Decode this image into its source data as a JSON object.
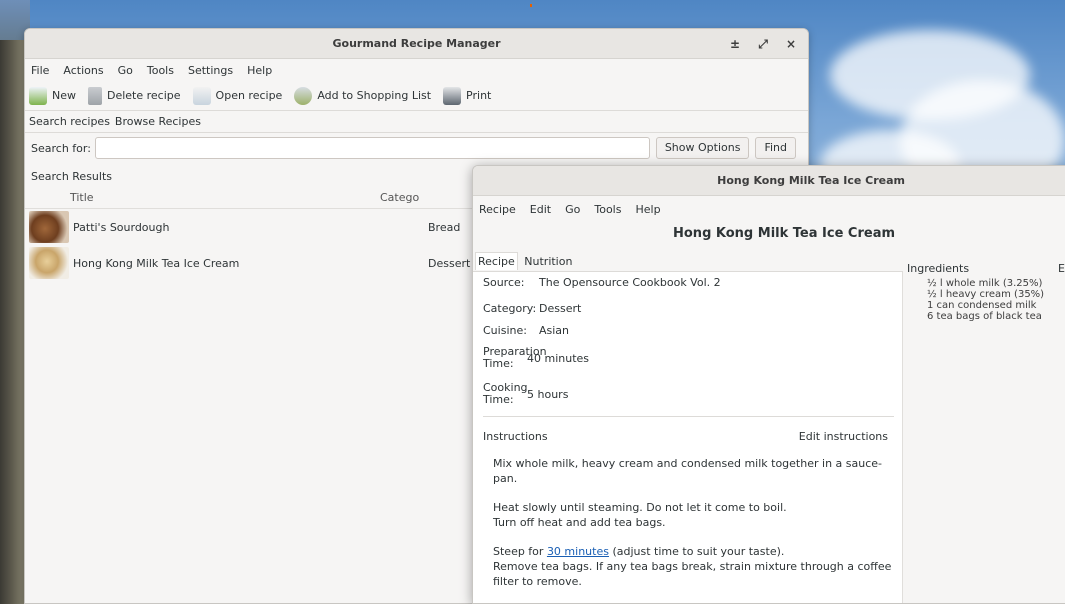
{
  "main_window": {
    "title": "Gourmand Recipe Manager",
    "controls": {
      "minimize": "±",
      "maximize": "⤢",
      "close": "×"
    },
    "menu": [
      "File",
      "Actions",
      "Go",
      "Tools",
      "Settings",
      "Help"
    ],
    "toolbar": {
      "new": "New",
      "delete": "Delete recipe",
      "open": "Open recipe",
      "shopping": "Add to Shopping List",
      "print": "Print"
    },
    "tabs": [
      "Search recipes",
      "Browse Recipes"
    ],
    "search_label": "Search for:",
    "search_value": "",
    "show_options": "Show Options",
    "find": "Find",
    "results_label": "Search Results",
    "columns": {
      "title": "Title",
      "category": "Catego"
    },
    "rows": [
      {
        "title": "Patti's Sourdough",
        "category": "Bread"
      },
      {
        "title": "Hong Kong Milk Tea Ice Cream",
        "category": "Dessert"
      }
    ]
  },
  "recipe_window": {
    "title": "Hong Kong Milk Tea Ice Cream",
    "menu": [
      "Recipe",
      "Edit",
      "Go",
      "Tools",
      "Help"
    ],
    "heading": "Hong Kong Milk Tea Ice Cream",
    "tabs": [
      "Recipe",
      "Nutrition"
    ],
    "fields": {
      "source_label": "Source:",
      "source_value": "The Opensource Cookbook Vol. 2",
      "category_label": "Category:",
      "category_value": "Dessert",
      "cuisine_label": "Cuisine:",
      "cuisine_value": "Asian",
      "prep_label": "Preparation Time:",
      "prep_value": "40 minutes",
      "cook_label": "Cooking Time:",
      "cook_value": "5 hours"
    },
    "instructions_label": "Instructions",
    "edit_instructions": "Edit instructions",
    "instructions": {
      "p1": "Mix whole milk, heavy cream and condensed milk together in a sauce-pan.",
      "p2a": "Heat slowly until steaming. Do not let it come to boil.",
      "p2b": "Turn off heat and add tea bags.",
      "p3_pre": "Steep for ",
      "p3_link": "30 minutes",
      "p3_post": " (adjust time to suit your taste).",
      "p3b": "Remove tea bags. If any tea bags break, strain mixture through a coffee filter to remove."
    },
    "ingredients_label": "Ingredients",
    "ingredients_extra": "E",
    "ingredients": [
      "½ l whole milk (3.25%)",
      "½ l heavy cream (35%)",
      "1 can condensed milk",
      "6 tea bags of black tea"
    ]
  }
}
